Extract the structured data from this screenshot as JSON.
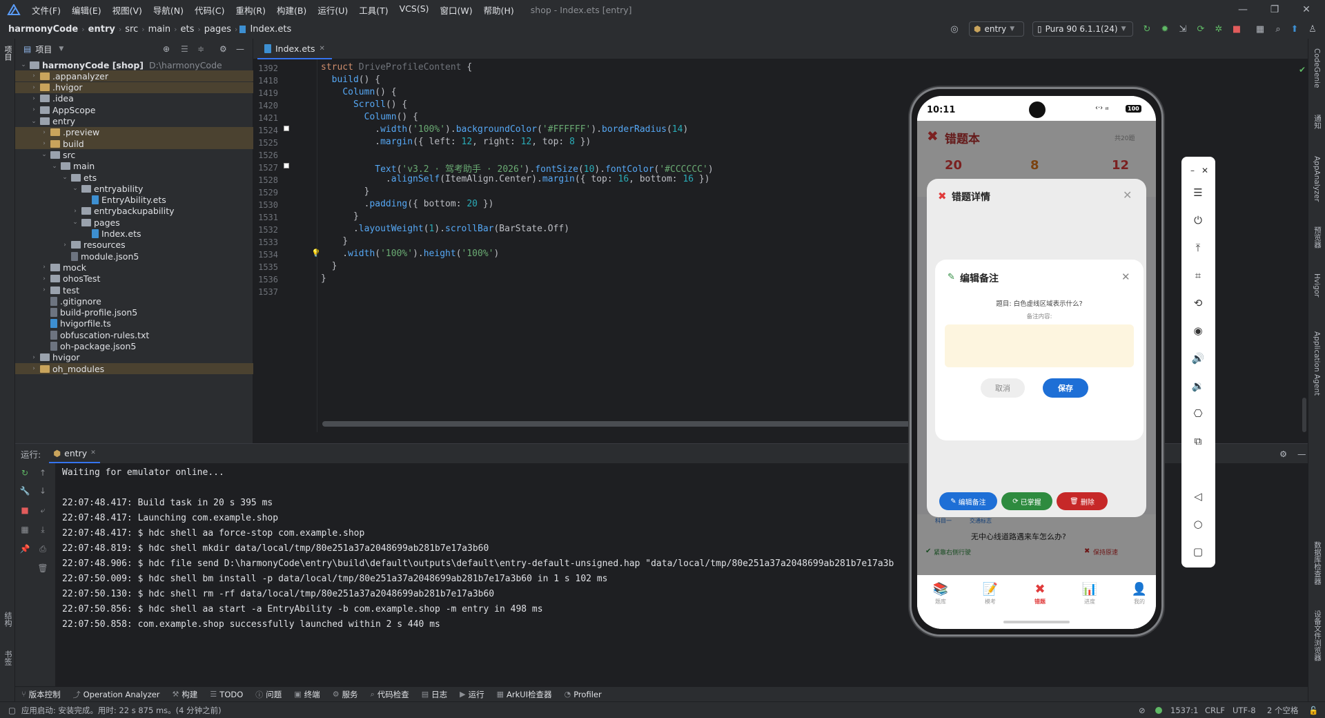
{
  "menu": {
    "items": [
      "文件(F)",
      "编辑(E)",
      "视图(V)",
      "导航(N)",
      "代码(C)",
      "重构(R)",
      "构建(B)",
      "运行(U)",
      "工具(T)",
      "VCS(S)",
      "窗口(W)",
      "帮助(H)"
    ],
    "window_title": "shop - Index.ets [entry]"
  },
  "nav": {
    "crumbs": [
      "harmonyCode",
      "entry",
      "src",
      "main",
      "ets",
      "pages",
      "Index.ets"
    ],
    "run_config": "entry",
    "device": "Pura 90 6.1.1(24)"
  },
  "left_strip": {
    "project": "项目",
    "structure": "结构",
    "bookmarks": "书签"
  },
  "project": {
    "header": "项目",
    "tree": [
      {
        "name": "harmonyCode [shop]",
        "path": "D:\\harmonyCode",
        "level": 0,
        "type": "folder",
        "open": true,
        "hl": false
      },
      {
        "name": ".appanalyzer",
        "level": 1,
        "type": "folder-o",
        "open": false,
        "hl": true
      },
      {
        "name": ".hvigor",
        "level": 1,
        "type": "folder-o",
        "open": false,
        "hl": true
      },
      {
        "name": ".idea",
        "level": 1,
        "type": "folder",
        "open": false,
        "hl": false
      },
      {
        "name": "AppScope",
        "level": 1,
        "type": "folder",
        "open": false,
        "hl": false
      },
      {
        "name": "entry",
        "level": 1,
        "type": "folder",
        "open": true,
        "hl": false
      },
      {
        "name": ".preview",
        "level": 2,
        "type": "folder-o",
        "open": false,
        "hl": true
      },
      {
        "name": "build",
        "level": 2,
        "type": "folder-o",
        "open": false,
        "hl": true
      },
      {
        "name": "src",
        "level": 2,
        "type": "folder",
        "open": true,
        "hl": false
      },
      {
        "name": "main",
        "level": 3,
        "type": "folder",
        "open": true,
        "hl": false
      },
      {
        "name": "ets",
        "level": 4,
        "type": "folder",
        "open": true,
        "hl": false
      },
      {
        "name": "entryability",
        "level": 5,
        "type": "folder",
        "open": true,
        "hl": false
      },
      {
        "name": "EntryAbility.ets",
        "level": 6,
        "type": "file-ts",
        "hl": false
      },
      {
        "name": "entrybackupability",
        "level": 5,
        "type": "folder",
        "open": false,
        "hl": false
      },
      {
        "name": "pages",
        "level": 5,
        "type": "folder",
        "open": true,
        "hl": false
      },
      {
        "name": "Index.ets",
        "level": 6,
        "type": "file-ts",
        "hl": false
      },
      {
        "name": "resources",
        "level": 4,
        "type": "folder",
        "open": false,
        "hl": false
      },
      {
        "name": "module.json5",
        "level": 4,
        "type": "file",
        "hl": false
      },
      {
        "name": "mock",
        "level": 2,
        "type": "folder",
        "open": false,
        "hl": false
      },
      {
        "name": "ohosTest",
        "level": 2,
        "type": "folder",
        "open": false,
        "hl": false
      },
      {
        "name": "test",
        "level": 2,
        "type": "folder",
        "open": false,
        "hl": false
      },
      {
        "name": ".gitignore",
        "level": 2,
        "type": "file",
        "hl": false
      },
      {
        "name": "build-profile.json5",
        "level": 2,
        "type": "file",
        "hl": false
      },
      {
        "name": "hvigorfile.ts",
        "level": 2,
        "type": "file-ts",
        "hl": false
      },
      {
        "name": "obfuscation-rules.txt",
        "level": 2,
        "type": "file",
        "hl": false
      },
      {
        "name": "oh-package.json5",
        "level": 2,
        "type": "file",
        "hl": false
      },
      {
        "name": "hvigor",
        "level": 1,
        "type": "folder",
        "open": false,
        "hl": false
      },
      {
        "name": "oh_modules",
        "level": 1,
        "type": "folder-o",
        "open": false,
        "hl": true
      }
    ]
  },
  "editor": {
    "tab": "Index.ets",
    "lines": [
      {
        "n": "1392",
        "seg": [
          [
            "kw",
            "struct "
          ],
          [
            "gr",
            "DriveProfileContent "
          ],
          [
            "",
            "{"
          ]
        ]
      },
      {
        "n": "1418",
        "seg": [
          [
            "",
            "  "
          ],
          [
            "fn",
            "build"
          ],
          [
            "",
            "() {"
          ]
        ]
      },
      {
        "n": "1419",
        "seg": [
          [
            "",
            "    "
          ],
          [
            "fn",
            "Column"
          ],
          [
            "",
            "() {"
          ]
        ]
      },
      {
        "n": "1420",
        "seg": [
          [
            "",
            "      "
          ],
          [
            "fn",
            "Scroll"
          ],
          [
            "",
            "() {"
          ]
        ]
      },
      {
        "n": "1421",
        "seg": [
          [
            "",
            "        "
          ],
          [
            "fn",
            "Column"
          ],
          [
            "",
            "() {"
          ]
        ]
      },
      {
        "n": "1524",
        "seg": [
          [
            "",
            "          ."
          ],
          [
            "fn",
            "width"
          ],
          [
            "",
            "("
          ],
          [
            "st",
            "'100%'"
          ],
          [
            "",
            ")."
          ],
          [
            "fn",
            "backgroundColor"
          ],
          [
            "",
            "("
          ],
          [
            "st",
            "'#FFFFFF'"
          ],
          [
            "",
            ")."
          ],
          [
            "fn",
            "borderRadius"
          ],
          [
            "",
            "("
          ],
          [
            "nm",
            "14"
          ],
          [
            "",
            ")"
          ]
        ]
      },
      {
        "n": "1525",
        "seg": [
          [
            "",
            "          ."
          ],
          [
            "fn",
            "margin"
          ],
          [
            "",
            "({ left: "
          ],
          [
            "nm",
            "12"
          ],
          [
            "",
            ", right: "
          ],
          [
            "nm",
            "12"
          ],
          [
            "",
            ", top: "
          ],
          [
            "nm",
            "8"
          ],
          [
            "",
            " })"
          ]
        ]
      },
      {
        "n": "1526",
        "seg": [
          [
            "",
            ""
          ]
        ]
      },
      {
        "n": "1527",
        "seg": [
          [
            "",
            "          "
          ],
          [
            "fn",
            "Text"
          ],
          [
            "",
            "("
          ],
          [
            "st",
            "'v3.2 · 驾考助手 · 2026'"
          ],
          [
            "",
            ")."
          ],
          [
            "fn",
            "fontSize"
          ],
          [
            "",
            "("
          ],
          [
            "nm",
            "10"
          ],
          [
            "",
            ")."
          ],
          [
            "fn",
            "fontColor"
          ],
          [
            "",
            "("
          ],
          [
            "st",
            "'#CCCCCC'"
          ],
          [
            "",
            ")"
          ]
        ]
      },
      {
        "n": "1528",
        "seg": [
          [
            "",
            "            ."
          ],
          [
            "fn",
            "alignSelf"
          ],
          [
            "",
            "(ItemAlign.Center)."
          ],
          [
            "fn",
            "margin"
          ],
          [
            "",
            "({ top: "
          ],
          [
            "nm",
            "16"
          ],
          [
            "",
            ", bottom: "
          ],
          [
            "nm",
            "16"
          ],
          [
            "",
            " })"
          ]
        ]
      },
      {
        "n": "1529",
        "seg": [
          [
            "",
            "        }"
          ]
        ]
      },
      {
        "n": "1530",
        "seg": [
          [
            "",
            "        ."
          ],
          [
            "fn",
            "padding"
          ],
          [
            "",
            "({ bottom: "
          ],
          [
            "nm",
            "20"
          ],
          [
            "",
            " })"
          ]
        ]
      },
      {
        "n": "1531",
        "seg": [
          [
            "",
            "      }"
          ]
        ]
      },
      {
        "n": "1532",
        "seg": [
          [
            "",
            "      ."
          ],
          [
            "fn",
            "layoutWeight"
          ],
          [
            "",
            "("
          ],
          [
            "nm",
            "1"
          ],
          [
            "",
            ")."
          ],
          [
            "fn",
            "scrollBar"
          ],
          [
            "",
            "(BarState.Off)"
          ]
        ]
      },
      {
        "n": "1533",
        "seg": [
          [
            "",
            "    }"
          ]
        ]
      },
      {
        "n": "1534",
        "seg": [
          [
            "",
            "    ."
          ],
          [
            "fn",
            "width"
          ],
          [
            "",
            "("
          ],
          [
            "st",
            "'100%'"
          ],
          [
            "",
            ")."
          ],
          [
            "fn",
            "height"
          ],
          [
            "",
            "("
          ],
          [
            "st",
            "'100%'"
          ],
          [
            "",
            ")"
          ]
        ]
      },
      {
        "n": "1535",
        "seg": [
          [
            "",
            "  }"
          ]
        ]
      },
      {
        "n": "1536",
        "seg": [
          [
            "",
            "}"
          ]
        ]
      },
      {
        "n": "1537",
        "seg": [
          [
            "",
            ""
          ]
        ]
      }
    ]
  },
  "run": {
    "label": "运行:",
    "tab": "entry",
    "lines": [
      "Waiting for emulator online...",
      "",
      "22:07:48.417: Build task in 20 s 395 ms",
      "22:07:48.417: Launching com.example.shop",
      "22:07:48.417: $ hdc shell aa force-stop com.example.shop",
      "22:07:48.819: $ hdc shell mkdir data/local/tmp/80e251a37a2048699ab281b7e17a3b60",
      "22:07:48.906: $ hdc file send D:\\harmonyCode\\entry\\build\\default\\outputs\\default\\entry-default-unsigned.hap \"data/local/tmp/80e251a37a2048699ab281b7e17a3b",
      "22:07:50.009: $ hdc shell bm install -p data/local/tmp/80e251a37a2048699ab281b7e17a3b60 in 1 s 102 ms",
      "22:07:50.130: $ hdc shell rm -rf data/local/tmp/80e251a37a2048699ab281b7e17a3b60",
      "22:07:50.856: $ hdc shell aa start -a EntryAbility -b com.example.shop -m entry in 498 ms",
      "22:07:50.858: com.example.shop successfully launched within 2 s 440 ms"
    ]
  },
  "right_strip": [
    "CodeGenie",
    "通知",
    "AppAnalyzer",
    "预览器",
    "Hvigor",
    "Application Agent",
    "数据库检查器",
    "设备文件浏览器"
  ],
  "bottom_tools": [
    [
      "⑂",
      "版本控制"
    ],
    [
      "⤴",
      "Operation Analyzer"
    ],
    [
      "⚒",
      "构建"
    ],
    [
      "☰",
      "TODO"
    ],
    [
      "ⓘ",
      "问题"
    ],
    [
      "▣",
      "终端"
    ],
    [
      "⚙",
      "服务"
    ],
    [
      "⌕",
      "代码检查"
    ],
    [
      "▤",
      "日志"
    ],
    [
      "▶",
      "运行"
    ],
    [
      "▦",
      "ArkUI检查器"
    ],
    [
      "◔",
      "Profiler"
    ]
  ],
  "status": {
    "message": "应用启动: 安装完成。用时: 22 s 875 ms。(4 分钟之前)",
    "pos": "1537:1",
    "eol": "CRLF",
    "enc": "UTF-8",
    "indent": "2 个空格"
  },
  "phone": {
    "time": "10:11",
    "battery": "100",
    "app_title": "错题本",
    "count": "共20题",
    "stats": [
      "20",
      "8",
      "12"
    ],
    "sheet_title": "错题详情",
    "dialog": {
      "title": "编辑备注",
      "question_label": "题目: 白色虚线区域表示什么?",
      "note_label": "备注内容:",
      "note_placeholder": "",
      "cancel": "取消",
      "save": "保存"
    },
    "actions": [
      "编辑备注",
      "已掌握",
      "删除"
    ],
    "card": {
      "tags": [
        "科目一",
        "交通标志"
      ],
      "question": "无中心线道路遇来车怎么办?",
      "right": "紧靠右侧行驶",
      "wrong": "保持原速"
    },
    "tabs": [
      "题库",
      "模考",
      "错题",
      "进度",
      "我的"
    ],
    "colors": {
      "accent": "#e03b3b",
      "blue": "#1e6fd6",
      "green": "#2e8b3f",
      "red": "#c62828",
      "note_bg": "#fdf5df"
    }
  }
}
